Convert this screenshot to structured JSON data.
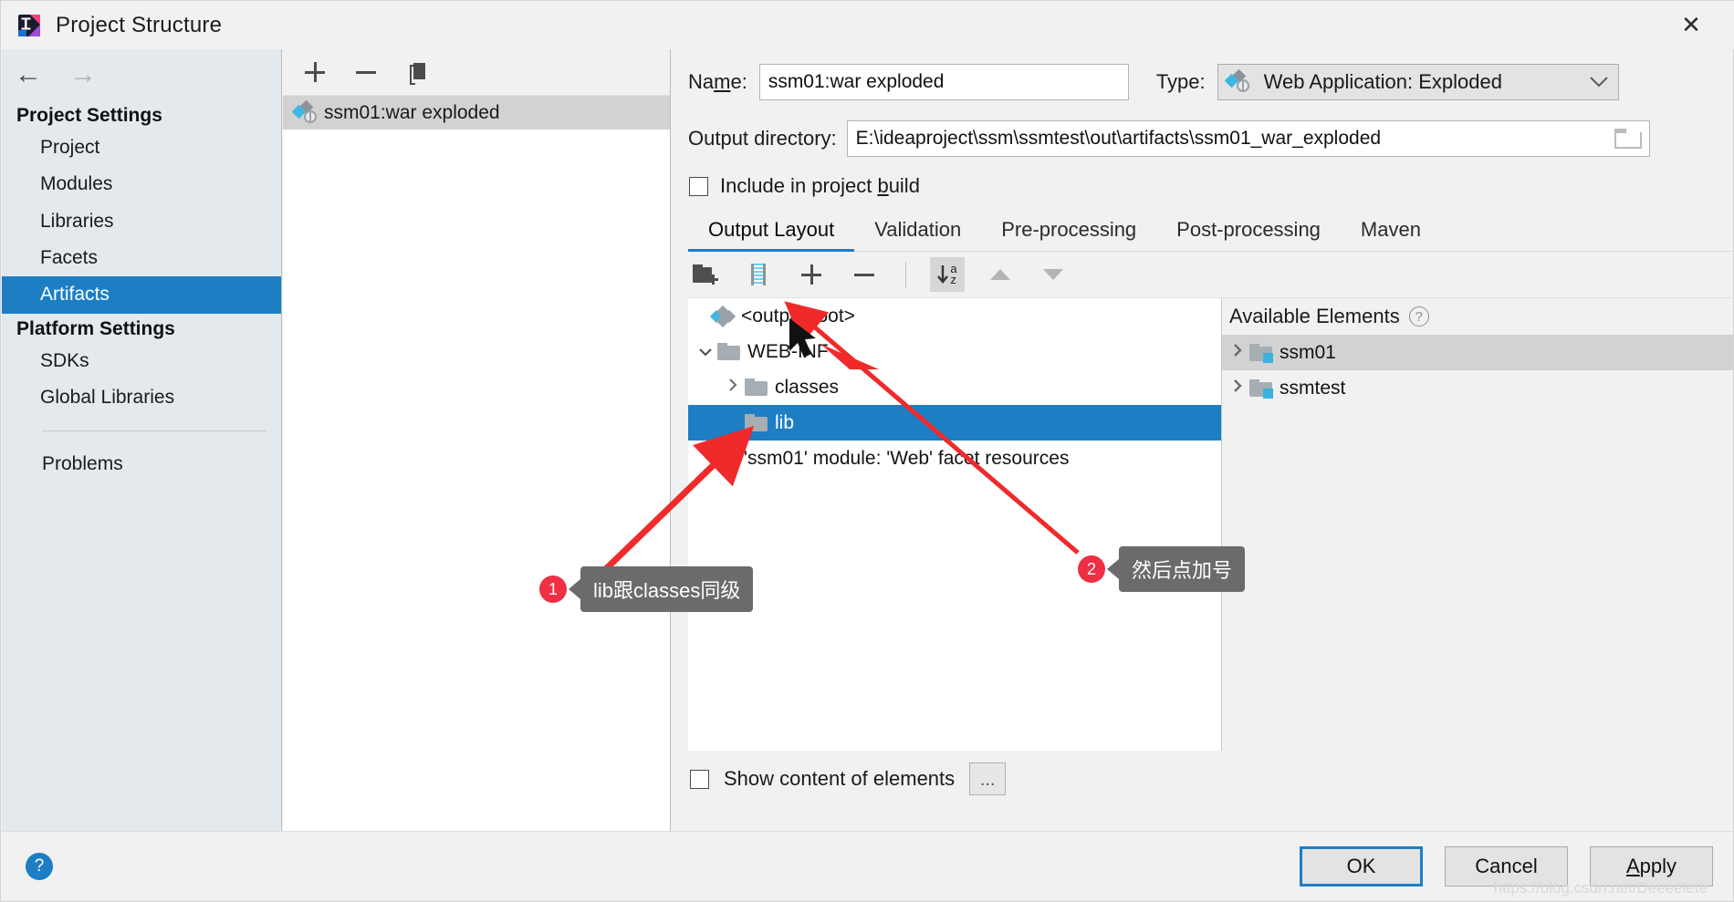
{
  "window": {
    "title": "Project Structure",
    "app_icon": "intellij-idea-icon",
    "close_label": "✕"
  },
  "sidebar": {
    "nav": {
      "back": "←",
      "forward": "→"
    },
    "groups": [
      {
        "title": "Project Settings",
        "items": [
          {
            "label": "Project",
            "selected": false
          },
          {
            "label": "Modules",
            "selected": false
          },
          {
            "label": "Libraries",
            "selected": false
          },
          {
            "label": "Facets",
            "selected": false
          },
          {
            "label": "Artifacts",
            "selected": true
          }
        ]
      },
      {
        "title": "Platform Settings",
        "items": [
          {
            "label": "SDKs",
            "selected": false
          },
          {
            "label": "Global Libraries",
            "selected": false
          }
        ]
      }
    ],
    "problems_label": "Problems"
  },
  "artifacts_panel": {
    "toolbar": {
      "add": "add-icon",
      "remove": "remove-icon",
      "copy": "copy-icon"
    },
    "items": [
      {
        "label": "ssm01:war exploded",
        "icon": "war-exploded-icon",
        "selected": true
      }
    ]
  },
  "detail": {
    "name_label": "Name:",
    "name_label_pre": "Na",
    "name_label_mnemonic": "m",
    "name_label_post": "e:",
    "name_value": "ssm01:war exploded",
    "type_label": "Type:",
    "type_value": "Web Application: Exploded",
    "type_chevron": "⌄",
    "output_dir_label": "Output directory:",
    "output_dir_value": "E:\\ideaproject\\ssm\\ssmtest\\out\\artifacts\\ssm01_war_exploded",
    "include_in_build": {
      "label_pre": "Include in project ",
      "label_mnemonic": "b",
      "label_post": "uild",
      "checked": false
    },
    "tabs": [
      {
        "label": "Output Layout",
        "active": true
      },
      {
        "label": "Validation",
        "active": false
      },
      {
        "label": "Pre-processing",
        "active": false
      },
      {
        "label": "Post-processing",
        "active": false
      },
      {
        "label": "Maven",
        "active": false
      }
    ],
    "layout_toolbar": [
      {
        "name": "create-directory-icon",
        "active": false
      },
      {
        "name": "create-archive-icon",
        "active": false
      },
      {
        "name": "add-icon",
        "active": false
      },
      {
        "name": "remove-icon",
        "active": false
      },
      {
        "name": "sort-alphabetically-icon",
        "active": true
      },
      {
        "name": "move-up-icon",
        "active": false
      },
      {
        "name": "move-down-icon",
        "active": false
      }
    ],
    "output_tree": [
      {
        "label": "<output root>",
        "icon": "output-root-icon",
        "indent": 0,
        "twisty": "",
        "selected": false
      },
      {
        "label": "WEB-INF",
        "icon": "folder-icon",
        "indent": 1,
        "twisty": "⌄",
        "selected": false
      },
      {
        "label": "classes",
        "icon": "folder-icon",
        "indent": 2,
        "twisty": "›",
        "selected": false
      },
      {
        "label": "lib",
        "icon": "folder-icon",
        "indent": 2,
        "twisty": "",
        "selected": true
      },
      {
        "label": "'ssm01' module: 'Web' facet resources",
        "icon": "facet-resources-icon",
        "indent": 1,
        "twisty": "",
        "selected": false
      }
    ],
    "available_elements": {
      "title": "Available Elements",
      "help_icon": "question-mark-icon",
      "items": [
        {
          "label": "ssm01",
          "icon": "module-folder-icon",
          "twisty": "›",
          "hover": true
        },
        {
          "label": "ssmtest",
          "icon": "module-folder-icon",
          "twisty": "›",
          "hover": false
        }
      ]
    },
    "show_content": {
      "label": "Show content of elements",
      "checked": false,
      "more_button": "..."
    }
  },
  "footer": {
    "help": "?",
    "buttons": [
      {
        "label": "OK",
        "default": true
      },
      {
        "label": "Cancel",
        "default": false
      },
      {
        "label": "Apply",
        "default": false,
        "mnemonic_first": true
      }
    ],
    "watermark": "https://blog.csdn.net/Deeeelete"
  },
  "annotations": [
    {
      "number": "1",
      "text": "lib跟classes同级"
    },
    {
      "number": "2",
      "text": "然后点加号"
    }
  ],
  "colors": {
    "accent": "#1d7ec4",
    "annotation_red": "#ef2f44",
    "bubble_gray": "#6b6b6b",
    "sidebar_bg": "#e4e9ed",
    "panel_bg": "#f1f1f1"
  }
}
